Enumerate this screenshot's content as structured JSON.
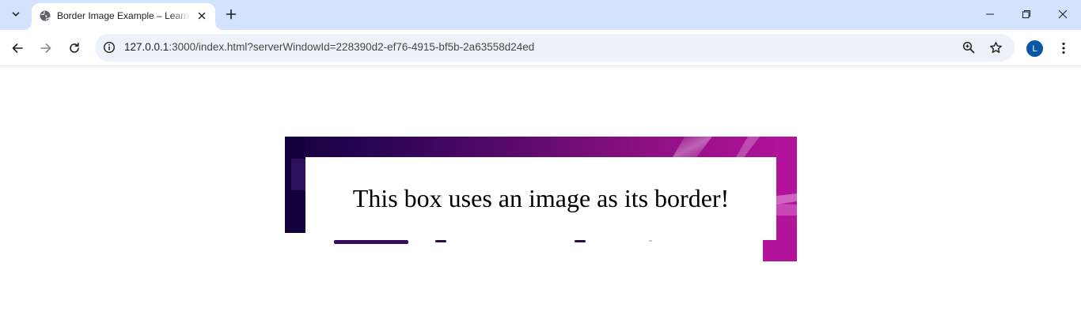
{
  "browser": {
    "tab": {
      "title": "Border Image Example – Learn Web Development",
      "favicon": "globe-icon"
    },
    "address_bar": {
      "host": "127.0.0.1",
      "path": ":3000/index.html?serverWindowId=228390d2-ef76-4915-bf5b-2a63558d24ed"
    },
    "profile_initial": "L"
  },
  "page": {
    "box_text": "This box uses an image as its border!"
  },
  "colors": {
    "tabstrip_bg": "#d3e3fd",
    "omnibox_bg": "#edf2fa",
    "profile_bg": "#0b57a4",
    "border_dark": "#1a0040",
    "border_mid": "#6a0a70",
    "border_light": "#b3129a"
  }
}
